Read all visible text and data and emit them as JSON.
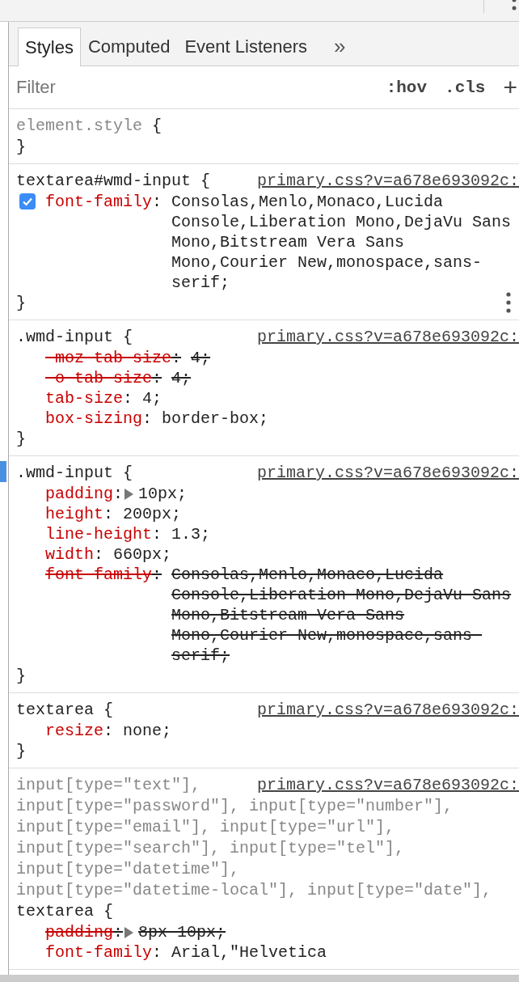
{
  "tabs": [
    {
      "label": "Styles",
      "selected": true
    },
    {
      "label": "Computed",
      "selected": false
    },
    {
      "label": "Event Listeners",
      "selected": false
    }
  ],
  "overflow_tabs": "»",
  "filter": {
    "placeholder": "Filter",
    "hov": ":hov",
    "cls": ".cls",
    "add": "+"
  },
  "rules": [
    {
      "selector": [
        {
          "text": "element.style",
          "matched": false
        }
      ],
      "open_brace": "{",
      "close_brace": "}",
      "menu": false
    },
    {
      "selector": [
        {
          "text": "textarea#wmd-input",
          "matched": true
        }
      ],
      "source": "primary.css?v=a678e693092c:",
      "open_brace": "{",
      "close_brace": "}",
      "menu": true,
      "properties": [
        {
          "name": "font-family",
          "colon": ":",
          "value": "Consolas,Menlo,Monaco,Lucida Console,Liberation Mono,DejaVu Sans Mono,Bitstream Vera Sans Mono,Courier New,monospace,sans-serif;",
          "checked": true,
          "overridden": false,
          "expandable": false
        }
      ]
    },
    {
      "selector": [
        {
          "text": ".wmd-input",
          "matched": true
        }
      ],
      "source": "primary.css?v=a678e693092c:",
      "open_brace": "{",
      "close_brace": "}",
      "menu": false,
      "properties": [
        {
          "name": "-moz-tab-size",
          "colon": ":",
          "value": "4;",
          "checked": false,
          "overridden": true,
          "expandable": false
        },
        {
          "name": "-o-tab-size",
          "colon": ":",
          "value": "4;",
          "checked": false,
          "overridden": true,
          "expandable": false
        },
        {
          "name": "tab-size",
          "colon": ":",
          "value": "4;",
          "checked": false,
          "overridden": false,
          "expandable": false
        },
        {
          "name": "box-sizing",
          "colon": ":",
          "value": "border-box;",
          "checked": false,
          "overridden": false,
          "expandable": false
        }
      ]
    },
    {
      "selector": [
        {
          "text": ".wmd-input",
          "matched": true
        }
      ],
      "source": "primary.css?v=a678e693092c:",
      "open_brace": "{",
      "close_brace": "}",
      "menu": false,
      "properties": [
        {
          "name": "padding",
          "colon": ":",
          "value": "10px;",
          "checked": false,
          "overridden": false,
          "expandable": true
        },
        {
          "name": "height",
          "colon": ":",
          "value": "200px;",
          "checked": false,
          "overridden": false,
          "expandable": false
        },
        {
          "name": "line-height",
          "colon": ":",
          "value": "1.3;",
          "checked": false,
          "overridden": false,
          "expandable": false
        },
        {
          "name": "width",
          "colon": ":",
          "value": "660px;",
          "checked": false,
          "overridden": false,
          "expandable": false
        },
        {
          "name": "font-family",
          "colon": ":",
          "value": "Consolas,Menlo,Monaco,Lucida Console,Liberation Mono,DejaVu Sans Mono,Bitstream Vera Sans Mono,Courier New,monospace,sans-serif;",
          "checked": false,
          "overridden": true,
          "expandable": false
        }
      ]
    },
    {
      "selector": [
        {
          "text": "textarea",
          "matched": true
        }
      ],
      "source": "primary.css?v=a678e693092c:",
      "open_brace": "{",
      "close_brace": "}",
      "menu": false,
      "properties": [
        {
          "name": "resize",
          "colon": ":",
          "value": "none;",
          "checked": false,
          "overridden": false,
          "expandable": false
        }
      ]
    },
    {
      "selector": [
        {
          "text": "input[type=\"text\"],",
          "matched": false
        },
        {
          "text": "input[type=\"password\"],",
          "matched": false
        },
        {
          "text": "input[type=\"number\"],",
          "matched": false
        },
        {
          "text": "input[type=\"email\"],",
          "matched": false
        },
        {
          "text": "input[type=\"url\"],",
          "matched": false
        },
        {
          "text": "input[type=\"search\"],",
          "matched": false
        },
        {
          "text": "input[type=\"tel\"],",
          "matched": false
        },
        {
          "text": "input[type=\"datetime\"],",
          "matched": false
        },
        {
          "text": "input[type=\"datetime-local\"],",
          "matched": false
        },
        {
          "text": "input[type=\"date\"],",
          "matched": false
        },
        {
          "text": "textarea",
          "matched": true
        }
      ],
      "source": "primary.css?v=a678e693092c:",
      "open_brace": "{",
      "menu": false,
      "properties": [
        {
          "name": "padding",
          "colon": ":",
          "value": "8px 10px;",
          "checked": false,
          "overridden": true,
          "expandable": true
        },
        {
          "name": "font-family",
          "colon": ":",
          "value": "Arial,\"Helvetica",
          "checked": false,
          "overridden": false,
          "expandable": false
        }
      ]
    }
  ]
}
